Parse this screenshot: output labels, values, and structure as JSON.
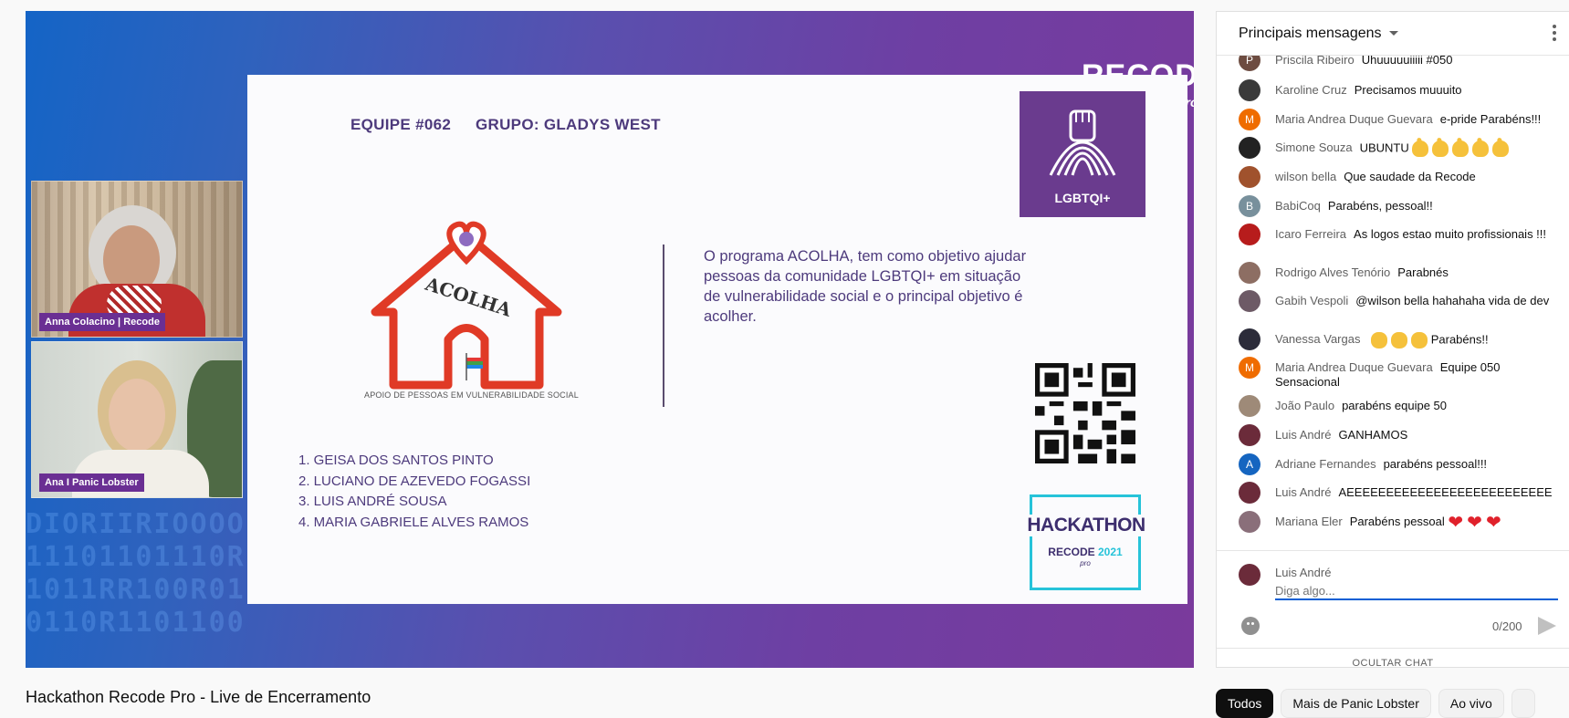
{
  "video": {
    "title": "Hackathon Recode Pro - Live de Encerramento",
    "binary_text": "DIORIIRIOOOO\n11101101110R\n1011RR100R01\n0110R1101100",
    "recode_mark": "RECODE",
    "recode_pro": "pro",
    "participants": [
      {
        "label": "Anna Colacino | Recode"
      },
      {
        "label": "Ana I Panic Lobster"
      }
    ],
    "slide": {
      "team": "EQUIPE #062",
      "group": "GRUPO: GLADYS WEST",
      "logo_text": "ACOLHA",
      "logo_caption": "APOIO DE PESSOAS EM VULNERABILIDADE SOCIAL",
      "description": "O programa ACOLHA, tem como objetivo ajudar pessoas da comunidade LGBTQI+ em situação de vulnerabilidade social e o principal objetivo é acolher.",
      "members": [
        "1. GEISA DOS SANTOS PINTO",
        "2. LUCIANO DE AZEVEDO FOGASSI",
        "3. LUIS ANDRÉ SOUSA",
        "4. MARIA GABRIELE ALVES RAMOS"
      ],
      "badge": "LGBTQI+",
      "hackathon_title": "HACKATHON",
      "hackathon_recode": "RECODE",
      "hackathon_year": "2021",
      "hackathon_pro": "pro"
    }
  },
  "chips": [
    "Todos",
    "Mais de Panic Lobster",
    "Ao vivo",
    ""
  ],
  "chat": {
    "header": "Principais mensagens",
    "messages": [
      {
        "author": "Priscila Ribeiro",
        "text": "Uhuuuuuiiiii #050",
        "avatar_letter": "P",
        "avatar_color": "#6d4c41"
      },
      {
        "author": "Karoline Cruz",
        "text": "Precisamos muuuito",
        "avatar_letter": "",
        "avatar_color": "#3a3a3a"
      },
      {
        "author": "Maria Andrea Duque Guevara",
        "text": "e-pride Parabéns!!!",
        "avatar_letter": "M",
        "avatar_color": "#ef6c00"
      },
      {
        "author": "Simone Souza",
        "text": "UBUNTU",
        "avatar_letter": "",
        "avatar_color": "#222222"
      },
      {
        "author": "wilson bella",
        "text": "Que saudade da Recode",
        "avatar_letter": "",
        "avatar_color": "#a0522d"
      },
      {
        "author": "BabiCoq",
        "text": "Parabéns, pessoal!!",
        "avatar_letter": "B",
        "avatar_color": "#78909c"
      },
      {
        "author": "Icaro Ferreira",
        "text": "As logos estao muito profissionais !!!",
        "avatar_letter": "",
        "avatar_color": "#b71c1c"
      },
      {
        "author": "Rodrigo Alves Tenório",
        "text": "Parabnés",
        "avatar_letter": "",
        "avatar_color": "#8d6e63"
      },
      {
        "author": "Gabih Vespoli",
        "text": "@wilson bella hahahaha vida de dev",
        "avatar_letter": "",
        "avatar_color": "#6d5a66"
      },
      {
        "author": "Vanessa Vargas",
        "text": "Parabéns!!",
        "avatar_letter": "",
        "avatar_color": "#2c2c3a"
      },
      {
        "author": "Maria Andrea Duque Guevara",
        "text": "Equipe 050 Sensacional",
        "avatar_letter": "M",
        "avatar_color": "#ef6c00"
      },
      {
        "author": "João Paulo",
        "text": "parabéns equipe 50",
        "avatar_letter": "",
        "avatar_color": "#9e8a78"
      },
      {
        "author": "Luis André",
        "text": "GANHAMOS",
        "avatar_letter": "",
        "avatar_color": "#6b2b3a"
      },
      {
        "author": "Adriane Fernandes",
        "text": "parabéns pessoal!!!",
        "avatar_letter": "A",
        "avatar_color": "#1565c0"
      },
      {
        "author": "Luis André",
        "text": "AEEEEEEEEEEEEEEEEEEEEEEEEEE",
        "avatar_letter": "",
        "avatar_color": "#6b2b3a"
      },
      {
        "author": "Mariana Eler",
        "text": "Parabéns pessoal",
        "avatar_letter": "",
        "avatar_color": "#8a6f7a"
      }
    ],
    "compose": {
      "name": "Luis André",
      "placeholder": "Diga algo...",
      "counter": "0/200",
      "hide_label": "OCULTAR CHAT"
    }
  },
  "colors": {
    "accent": "#065fd4",
    "slide_text": "#4d3a7c",
    "badge_purple": "#6a3b8e",
    "hackathon_cyan": "#26c3d9"
  }
}
